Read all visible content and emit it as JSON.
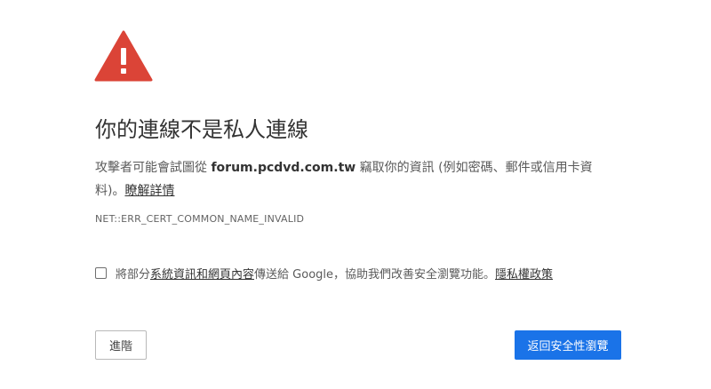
{
  "interstitial": {
    "icon": "warning-triangle-icon",
    "icon_color": "#db4437",
    "title": "你的連線不是私人連線",
    "explanation_prefix": "攻擊者可能會試圖從",
    "explanation_host": "forum.pcdvd.com.tw",
    "explanation_suffix": "竊取你的資訊 (例如密碼、郵件或信用卡資料)。",
    "learn_more": "瞭解詳情",
    "error_code": "NET::ERR_CERT_COMMON_NAME_INVALID",
    "report": {
      "checked": false,
      "prefix": "將部分",
      "link": "系統資訊和網頁內容",
      "middle": "傳送給 Google，協助我們改善安全瀏覽功能。",
      "privacy_link": "隱私權政策"
    },
    "advanced_button": "進階",
    "back_button": "返回安全性瀏覽",
    "back_button_color": "#1a73e8"
  }
}
